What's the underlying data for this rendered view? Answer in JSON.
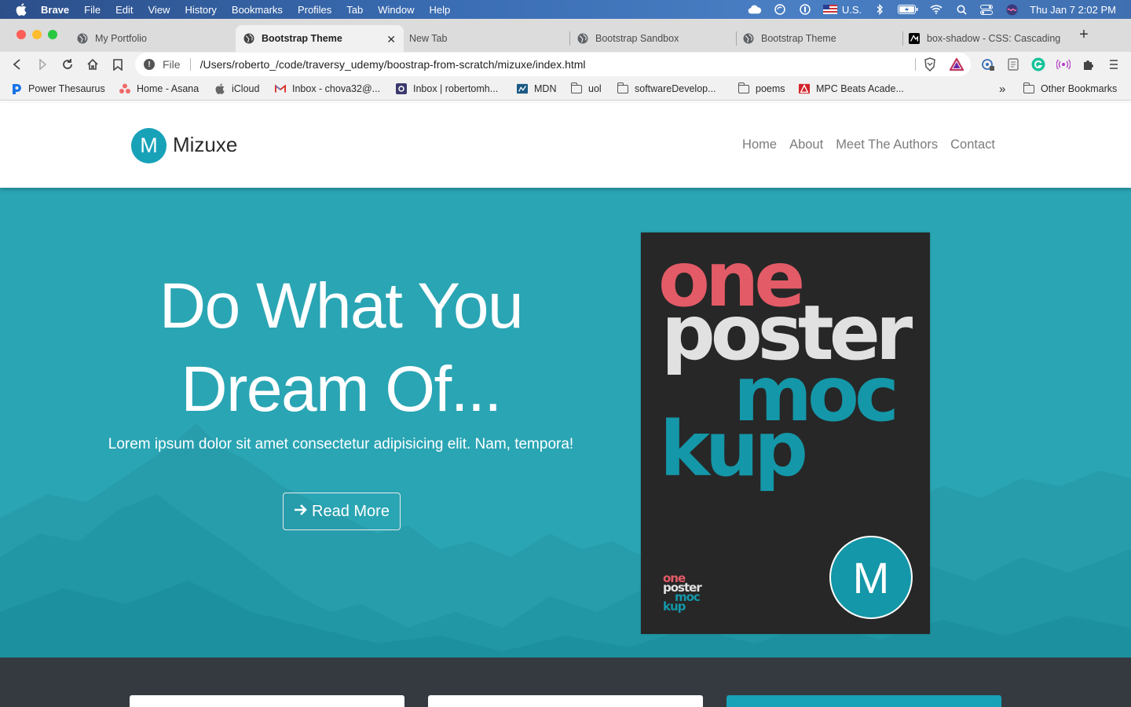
{
  "menubar": {
    "app_name": "Brave",
    "items": [
      "File",
      "Edit",
      "View",
      "History",
      "Bookmarks",
      "Profiles",
      "Tab",
      "Window",
      "Help"
    ],
    "input_source": "U.S.",
    "clock": "Thu Jan 7  2:02 PM"
  },
  "tabs": [
    {
      "label": "My Portfolio",
      "icon": "globe-icon",
      "active": false
    },
    {
      "label": "Bootstrap Theme",
      "icon": "globe-icon",
      "active": true
    },
    {
      "label": "New Tab",
      "icon": "",
      "active": false
    },
    {
      "label": "Bootstrap Sandbox",
      "icon": "globe-icon",
      "active": false
    },
    {
      "label": "Bootstrap Theme",
      "icon": "globe-icon",
      "active": false
    },
    {
      "label": "box-shadow - CSS: Cascading",
      "icon": "mdn-icon",
      "active": false
    }
  ],
  "address_bar": {
    "scheme": "File",
    "url": "/Users/roberto_/code/traversy_udemy/boostrap-from-scratch/mizuxe/index.html"
  },
  "bookmarks": [
    {
      "label": "Power Thesaurus",
      "icon": "power-thesaurus-icon"
    },
    {
      "label": "Home - Asana",
      "icon": "asana-icon"
    },
    {
      "label": "iCloud",
      "icon": "apple-icon"
    },
    {
      "label": "Inbox - chova32@...",
      "icon": "gmail-icon"
    },
    {
      "label": "Inbox | robertomh...",
      "icon": "protonmail-icon"
    },
    {
      "label": "MDN",
      "icon": "mdn-icon"
    },
    {
      "label": "uol",
      "icon": "folder-icon"
    },
    {
      "label": "softwareDevelop...",
      "icon": "folder-icon"
    },
    {
      "label": "poems",
      "icon": "folder-icon"
    },
    {
      "label": "MPC Beats Acade...",
      "icon": "mpc-icon"
    }
  ],
  "bookmarks_overflow": "»",
  "other_bookmarks": "Other Bookmarks",
  "site": {
    "brand_letter": "M",
    "brand_name": "Mizuxe",
    "nav": [
      "Home",
      "About",
      "Meet The Authors",
      "Contact"
    ],
    "hero": {
      "title_line1": "Do What You",
      "title_line2": "Dream Of...",
      "subtitle": "Lorem ipsum dolor sit amet consectetur adipisicing elit. Nam, tempora!",
      "button_label": "Read More"
    },
    "poster": {
      "word1": "one",
      "word2": "poster",
      "word3": "moc",
      "word4": "kup",
      "badge_letter": "M"
    }
  },
  "colors": {
    "brand_primary": "#17a2b8",
    "hero_bg": "#2aa5b4",
    "poster_bg": "#272727",
    "poster_red": "#e35b67",
    "poster_teal": "#1497a8",
    "dark_section": "#343a40"
  }
}
